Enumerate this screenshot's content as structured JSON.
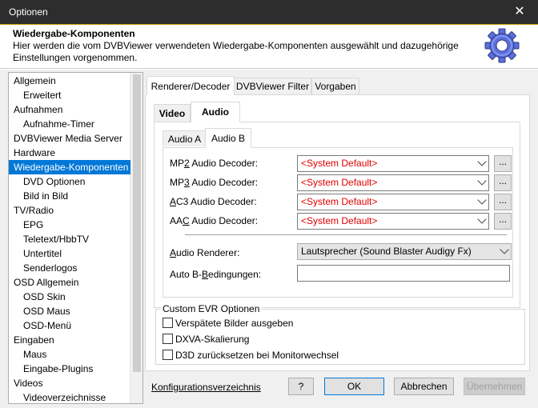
{
  "window": {
    "title": "Optionen",
    "close_glyph": "✕"
  },
  "header": {
    "title": "Wiedergabe-Komponenten",
    "description": "Hier werden die vom DVBViewer verwendeten Wiedergabe-Komponenten ausgewählt und dazugehörige Einstellungen vorgenommen.",
    "icon": "gear-icon",
    "icon_color": "#5a6fd8"
  },
  "tree": {
    "items": [
      {
        "label": "Allgemein",
        "level": 0
      },
      {
        "label": "Erweitert",
        "level": 1
      },
      {
        "label": "Aufnahmen",
        "level": 0
      },
      {
        "label": "Aufnahme-Timer",
        "level": 1
      },
      {
        "label": "DVBViewer Media Server",
        "level": 0
      },
      {
        "label": "Hardware",
        "level": 0
      },
      {
        "label": "Wiedergabe-Komponenten",
        "level": 0,
        "selected": true
      },
      {
        "label": "DVD Optionen",
        "level": 1
      },
      {
        "label": "Bild in Bild",
        "level": 1
      },
      {
        "label": "TV/Radio",
        "level": 0
      },
      {
        "label": "EPG",
        "level": 1
      },
      {
        "label": "Teletext/HbbTV",
        "level": 1
      },
      {
        "label": "Untertitel",
        "level": 1
      },
      {
        "label": "Senderlogos",
        "level": 1
      },
      {
        "label": "OSD Allgemein",
        "level": 0
      },
      {
        "label": "OSD Skin",
        "level": 1
      },
      {
        "label": "OSD Maus",
        "level": 1
      },
      {
        "label": "OSD-Menü",
        "level": 1
      },
      {
        "label": "Eingaben",
        "level": 0
      },
      {
        "label": "Maus",
        "level": 1
      },
      {
        "label": "Eingabe-Plugins",
        "level": 1
      },
      {
        "label": "Videos",
        "level": 0
      },
      {
        "label": "Videoverzeichnisse",
        "level": 1
      }
    ],
    "selected_color": "#0078d7"
  },
  "tabs": {
    "main": [
      "Renderer/Decoder",
      "DVBViewer Filter",
      "Vorgaben"
    ],
    "sub": [
      "Video",
      "Audio"
    ],
    "audio": [
      "Audio A",
      "Audio B"
    ]
  },
  "audio_b": {
    "decoders": [
      {
        "pre": "MP",
        "acc": "2",
        "post": " Audio Decoder:",
        "value": "<System Default>"
      },
      {
        "pre": "MP",
        "acc": "3",
        "post": " Audio Decoder:",
        "value": "<System Default>"
      },
      {
        "pre": "",
        "acc": "A",
        "post": "C3 Audio Decoder:",
        "value": "<System Default>"
      },
      {
        "pre": "AA",
        "acc": "C",
        "post": " Audio Decoder:",
        "value": "<System Default>"
      }
    ],
    "dots_label": "...",
    "renderer": {
      "pre": "",
      "acc": "A",
      "post": "udio Renderer:",
      "value": "Lautsprecher (Sound Blaster Audigy Fx)"
    },
    "auto_b": {
      "pre": "Auto B-",
      "acc": "B",
      "post": "edingungen:",
      "value": ""
    }
  },
  "custom_evr": {
    "title": "Custom EVR Optionen",
    "options": [
      {
        "label": "Verspätete Bilder ausgeben",
        "checked": false
      },
      {
        "label": "DXVA-Skalierung",
        "checked": false
      },
      {
        "label": "D3D zurücksetzen bei Monitorwechsel",
        "checked": false
      }
    ]
  },
  "footer": {
    "link": "Konfigurationsverzeichnis",
    "help": "?",
    "ok": "OK",
    "cancel": "Abbrechen",
    "apply": "Übernehmen"
  },
  "colors": {
    "titlebar": "#2d2d2d",
    "accent": "#0078d7",
    "error_text": "#e00000"
  }
}
